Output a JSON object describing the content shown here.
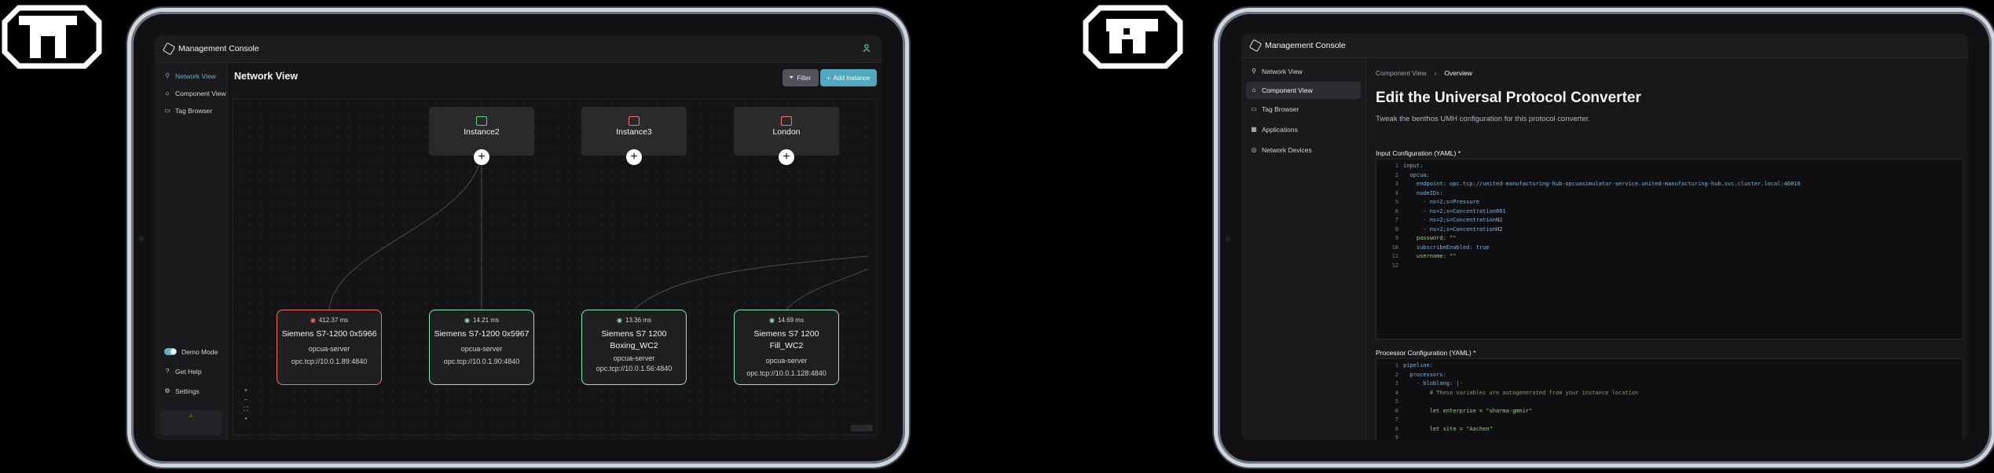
{
  "left_window": {
    "title": "Management Console",
    "sidebar": [
      {
        "label": "Network View",
        "icon": "network-icon",
        "active": true
      },
      {
        "label": "Component View",
        "icon": "component-icon",
        "active": false
      },
      {
        "label": "Tag Browser",
        "icon": "tag-icon",
        "active": false
      }
    ],
    "sidebar_bottom": {
      "demo_mode": "Demo Mode",
      "get_help": "Get Help",
      "settings": "Settings"
    },
    "page_title": "Network View",
    "filter_label": "Filter",
    "add_instance_label": "Add Instance",
    "instances": [
      {
        "name": "Instance2",
        "color": "#4ade80"
      },
      {
        "name": "Instance3",
        "color": "#f87171"
      },
      {
        "name": "London",
        "color": "#f87171"
      }
    ],
    "devices": [
      {
        "latency": "412.37 ms",
        "name": "Siemens S7-1200 0x5966",
        "type": "opcua-server",
        "address": "opc.tcp://10.0.1.89:4840",
        "status_color": "#f87171"
      },
      {
        "latency": "14.21 ms",
        "name": "Siemens S7-1200 0x5967",
        "type": "opcua-server",
        "address": "opc.tcp://10.0.1.90:4840",
        "status_color": "#86efac"
      },
      {
        "latency": "13.36 ms",
        "name": "Siemens S7 1200 Boxing_WC2",
        "type": "opcua-server",
        "address": "opc.tcp://10.0.1.56:4840",
        "status_color": "#86efac"
      },
      {
        "latency": "14.69 ms",
        "name": "Siemens S7 1200 Fill_WC2",
        "type": "opcua-server",
        "address": "opc.tcp://10.0.1.128:4840",
        "status_color": "#86efac"
      }
    ]
  },
  "right_window": {
    "title": "Management Console",
    "sidebar": [
      {
        "label": "Network View",
        "icon": "network-icon",
        "active": false
      },
      {
        "label": "Component View",
        "icon": "component-icon",
        "active": true
      },
      {
        "label": "Tag Browser",
        "icon": "tag-icon",
        "active": false
      },
      {
        "label": "Applications",
        "icon": "applications-icon",
        "active": false
      },
      {
        "label": "Network Devices",
        "icon": "network-devices-icon",
        "active": false
      }
    ],
    "breadcrumb": [
      "Component View",
      "Overview"
    ],
    "page_title": "Edit the Universal Protocol Converter",
    "page_subtitle": "Tweak the benthos UMH configuration for this protocol converter.",
    "input_label": "Input Configuration (YAML) *",
    "input_lines": [
      "input:",
      "  opcua:",
      "    endpoint: opc.tcp://united-manufacturing-hub-opcuasimulator-service.united-manufacturing-hub.svc.cluster.local:46010",
      "    nodeIDs:",
      "      - ns=2;s=Pressure",
      "      - ns=2;s=Concentration001",
      "      - ns=2;s=ConcentrationN2",
      "      - ns=2;s=ConcentrationH2",
      "    password: \"\"",
      "    subscribeEnabled: true",
      "    username: \"\"",
      ""
    ],
    "processor_label": "Processor Configuration (YAML) *",
    "processor_lines": [
      "pipeline:",
      "  processors:",
      "    - bloblang: |-",
      "        # These variables are autogenerated from your instance location",
      "",
      "        let enterprise = \"sharma-gmnir\"",
      "",
      "        let site = \"Aachen\"",
      ""
    ]
  }
}
